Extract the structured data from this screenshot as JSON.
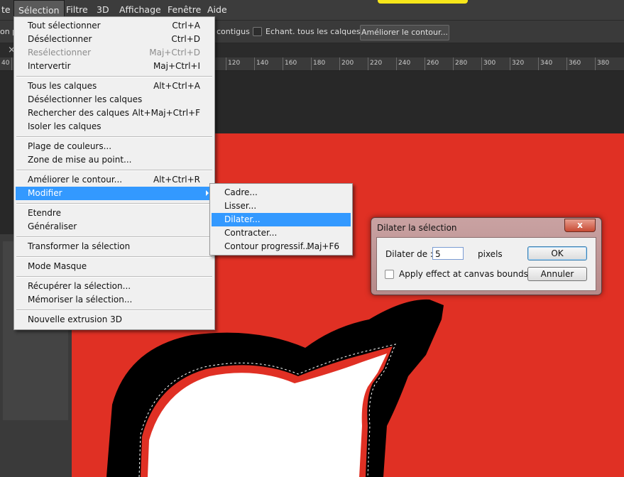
{
  "menubar": {
    "items": [
      {
        "label": "te"
      },
      {
        "label": "Sélection"
      },
      {
        "label": "Filtre"
      },
      {
        "label": "3D"
      },
      {
        "label": "Affichage"
      },
      {
        "label": "Fenêtre"
      },
      {
        "label": "Aide"
      }
    ]
  },
  "options_bar": {
    "left_text": "on p",
    "contiguous_label": "contigus",
    "sample_all_label": "Echant. tous les calques",
    "refine_edge_label": "Améliorer le contour..."
  },
  "tabs": {
    "close_glyph": "×"
  },
  "ruler": {
    "ticks": [
      "40",
      "120",
      "140",
      "160",
      "180",
      "200",
      "220",
      "240",
      "260",
      "280",
      "300",
      "320",
      "340",
      "360",
      "380"
    ]
  },
  "select_menu": {
    "items": [
      {
        "label": "Tout sélectionner",
        "shortcut": "Ctrl+A"
      },
      {
        "label": "Désélectionner",
        "shortcut": "Ctrl+D"
      },
      {
        "label": "Resélectionner",
        "shortcut": "Maj+Ctrl+D"
      },
      {
        "label": "Intervertir",
        "shortcut": "Maj+Ctrl+I"
      },
      {
        "label": "Tous les calques",
        "shortcut": "Alt+Ctrl+A"
      },
      {
        "label": "Désélectionner les calques",
        "shortcut": ""
      },
      {
        "label": "Rechercher des calques",
        "shortcut": "Alt+Maj+Ctrl+F"
      },
      {
        "label": "Isoler les calques",
        "shortcut": ""
      },
      {
        "label": "Plage de couleurs...",
        "shortcut": ""
      },
      {
        "label": "Zone de mise au point...",
        "shortcut": ""
      },
      {
        "label": "Améliorer le contour...",
        "shortcut": "Alt+Ctrl+R"
      },
      {
        "label": "Modifier",
        "shortcut": ""
      },
      {
        "label": "Etendre",
        "shortcut": ""
      },
      {
        "label": "Généraliser",
        "shortcut": ""
      },
      {
        "label": "Transformer la sélection",
        "shortcut": ""
      },
      {
        "label": "Mode Masque",
        "shortcut": ""
      },
      {
        "label": "Récupérer la sélection...",
        "shortcut": ""
      },
      {
        "label": "Mémoriser la sélection...",
        "shortcut": ""
      },
      {
        "label": "Nouvelle extrusion 3D",
        "shortcut": ""
      }
    ]
  },
  "modify_submenu": {
    "items": [
      {
        "label": "Cadre...",
        "shortcut": ""
      },
      {
        "label": "Lisser...",
        "shortcut": ""
      },
      {
        "label": "Dilater...",
        "shortcut": ""
      },
      {
        "label": "Contracter...",
        "shortcut": ""
      },
      {
        "label": "Contour progressif...",
        "shortcut": "Maj+F6"
      }
    ]
  },
  "dialog": {
    "title": "Dilater la sélection",
    "close_glyph": "x",
    "expand_label": "Dilater de :",
    "expand_value": "5",
    "unit": "pixels",
    "canvas_bounds_label": "Apply effect at canvas bounds",
    "ok_label": "OK",
    "cancel_label": "Annuler"
  },
  "colors": {
    "canvas_red": "#e03024",
    "highlight": "#3399ff"
  }
}
